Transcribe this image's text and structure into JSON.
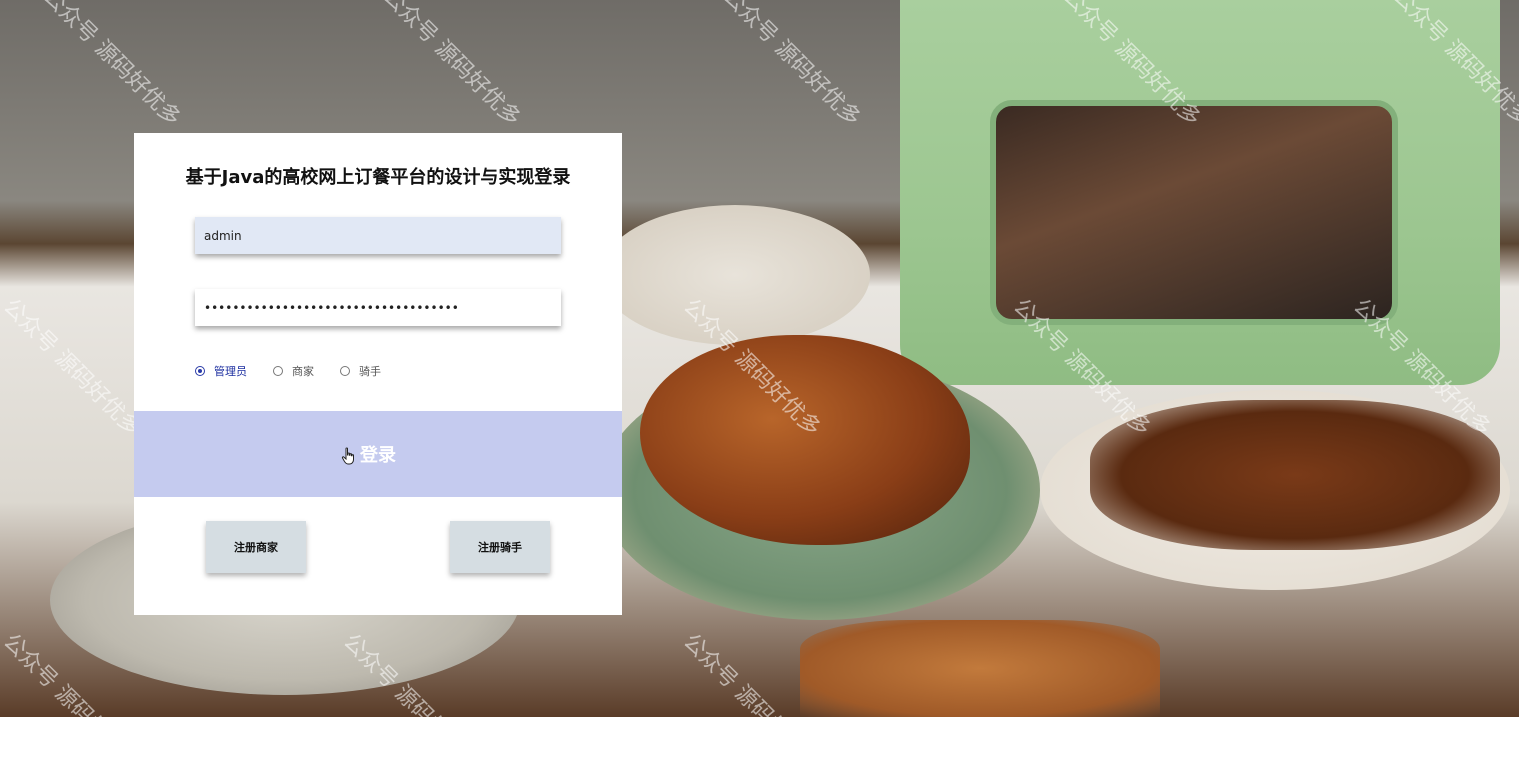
{
  "title": "基于Java的高校网上订餐平台的设计与实现登录",
  "username": {
    "value": "admin"
  },
  "password": {
    "value": "••••••••••••••••••••••••••••••••••••"
  },
  "roles": [
    {
      "label": "管理员",
      "selected": true
    },
    {
      "label": "商家",
      "selected": false
    },
    {
      "label": "骑手",
      "selected": false
    }
  ],
  "login_label": "登录",
  "register_merchant_label": "注册商家",
  "register_rider_label": "注册骑手",
  "watermark_text": "公众号 源码好优多",
  "colors": {
    "login_button": "#c5cbef",
    "username_field": "#e1e8f5",
    "register_button": "#d5dde2",
    "selected_role": "#1d2fa0"
  }
}
